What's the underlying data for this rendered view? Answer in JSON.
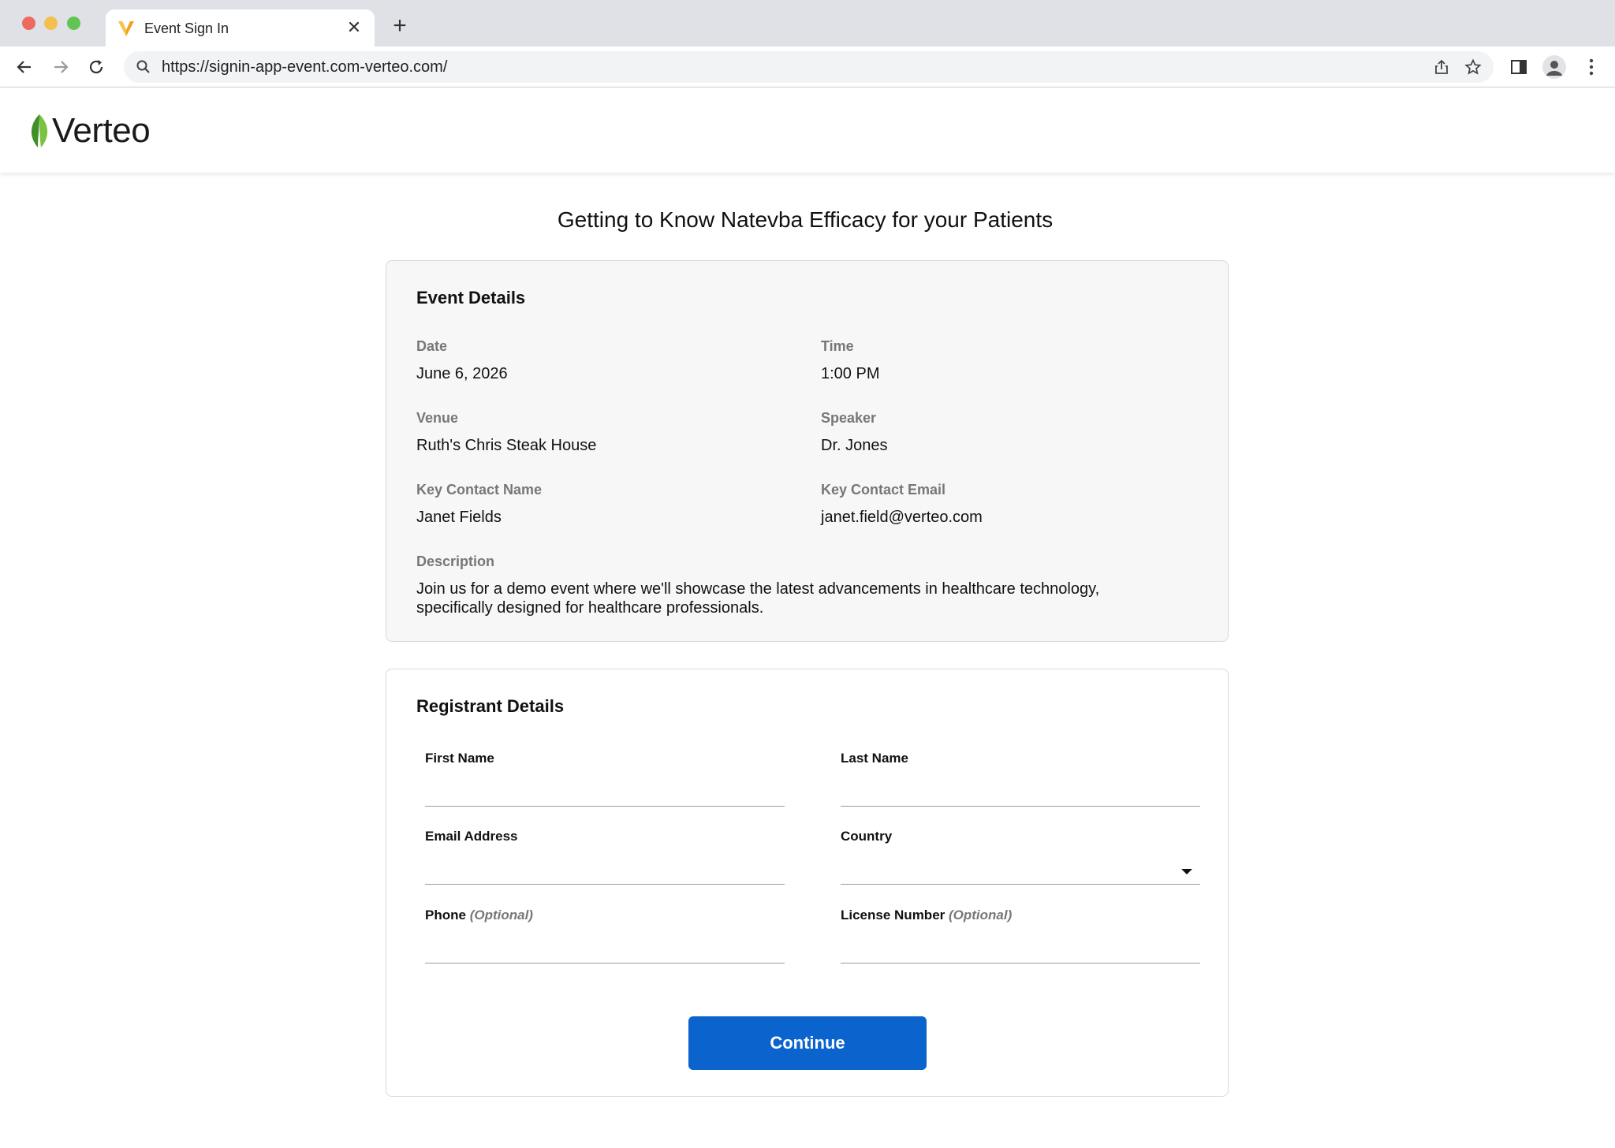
{
  "browser": {
    "tab_title": "Event Sign In",
    "url": "https://signin-app-event.com-verteo.com/"
  },
  "header": {
    "logo_text": "Verteo"
  },
  "page": {
    "title": "Getting to Know Natevba Efficacy for your Patients"
  },
  "event": {
    "heading": "Event Details",
    "date_label": "Date",
    "date_value": "June 6, 2026",
    "time_label": "Time",
    "time_value": "1:00 PM",
    "venue_label": "Venue",
    "venue_value": "Ruth's Chris Steak House",
    "speaker_label": "Speaker",
    "speaker_value": "Dr. Jones",
    "contact_name_label": "Key Contact Name",
    "contact_name_value": "Janet Fields",
    "contact_email_label": "Key Contact Email",
    "contact_email_value": "janet.field@verteo.com",
    "description_label": "Description",
    "description_value": "Join us for a demo event where we'll showcase the latest advancements in healthcare technology, specifically designed for healthcare professionals."
  },
  "registrant": {
    "heading": "Registrant Details",
    "first_name_label": "First Name",
    "last_name_label": "Last Name",
    "email_label": "Email Address",
    "country_label": "Country",
    "phone_label": "Phone",
    "license_label": "License Number",
    "optional_text": "(Optional)",
    "continue_label": "Continue"
  },
  "colors": {
    "primary_button": "#0b63ce",
    "logo_leaf": "#5aa832"
  }
}
